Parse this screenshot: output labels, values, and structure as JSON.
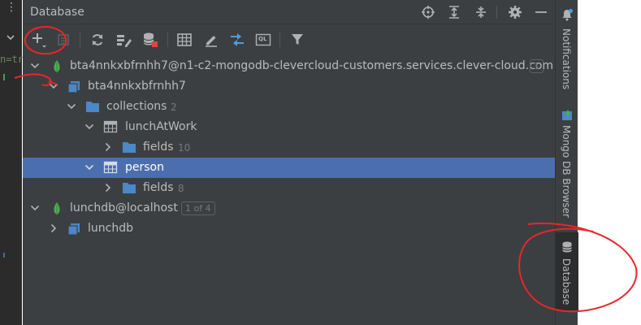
{
  "panel": {
    "title": "Database",
    "header_buttons": [
      "crosshair-icon",
      "expand-all-icon",
      "collapse-all-icon",
      "gear-icon",
      "minimize-icon"
    ]
  },
  "toolbar": {
    "buttons": [
      "add-icon",
      "properties-icon",
      "refresh-icon",
      "data-source-settings-icon",
      "stop-icon",
      "table-editor-icon",
      "edit-source-icon",
      "jump-to-query-console-icon",
      "query-console-icon",
      "filter-icon"
    ],
    "query_console_label": "QL"
  },
  "tree": {
    "rows": [
      {
        "label": "bta4nnkxbfrnhh7@n1-c2-mongodb-clevercloud-customers.services.clever-cloud.com",
        "badge": "1",
        "icon": "mongodb-leaf-icon",
        "expanded": true
      },
      {
        "label": "bta4nnkxbfrnhh7",
        "icon": "database-icon",
        "expanded": true
      },
      {
        "label": "collections",
        "count": "2",
        "icon": "folder-icon",
        "expanded": true
      },
      {
        "label": "lunchAtWork",
        "icon": "table-icon",
        "expanded": true
      },
      {
        "label": "fields",
        "count": "10",
        "icon": "folder-icon",
        "expanded": false
      },
      {
        "label": "person",
        "icon": "table-icon",
        "expanded": true,
        "selected": true
      },
      {
        "label": "fields",
        "count": "8",
        "icon": "folder-icon",
        "expanded": false
      },
      {
        "label": "lunchdb@localhost",
        "badge": "1 of 4",
        "icon": "mongodb-leaf-icon",
        "expanded": true
      },
      {
        "label": "lunchdb",
        "icon": "database-icon",
        "expanded": false
      }
    ]
  },
  "editor": {
    "code_fragment": "n=tr"
  },
  "side_tabs": {
    "notifications": "Notifications",
    "mongo": "Mongo DB Browser",
    "database": "Database"
  },
  "colors": {
    "panel_bg": "#3c3f41",
    "selection": "#4b6eaf",
    "folder": "#4a88c7",
    "mongodb_green": "#4caf50",
    "annotation_red": "#e8262a"
  }
}
